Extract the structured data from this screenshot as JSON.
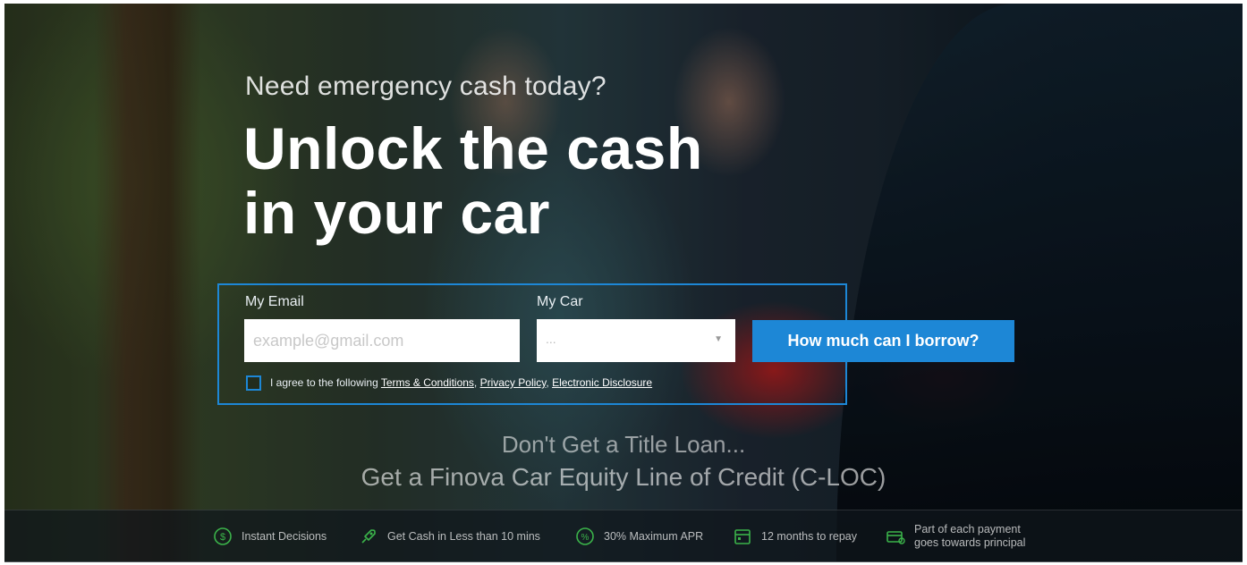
{
  "hero": {
    "tagline": "Need emergency cash today?",
    "headline_line1": "Unlock the cash",
    "headline_line2": "in your car"
  },
  "form": {
    "email_label": "My Email",
    "email_placeholder": "example@gmail.com",
    "car_label": "My Car",
    "car_select_value": "...",
    "submit_label": "How much can I borrow?",
    "agree_prefix": "I agree to the following",
    "terms_link": "Terms & Conditions",
    "privacy_link": "Privacy Policy",
    "disclosure_link": "Electronic Disclosure"
  },
  "subheadline": {
    "line1": "Don't Get a Title Loan...",
    "line2": "Get a Finova Car Equity Line of Credit (C-LOC)"
  },
  "features": [
    {
      "icon": "dollar-icon",
      "label": "Instant Decisions"
    },
    {
      "icon": "rocket-icon",
      "label": "Get Cash in Less than 10 mins"
    },
    {
      "icon": "percent-icon",
      "label": "30% Maximum APR"
    },
    {
      "icon": "calendar-icon",
      "label": "12 months to repay"
    },
    {
      "icon": "payment-icon",
      "label_line1": "Part of each payment",
      "label_line2": "goes towards principal"
    }
  ],
  "colors": {
    "accent_blue": "#1d87d6",
    "feature_green": "#3bb34a"
  }
}
